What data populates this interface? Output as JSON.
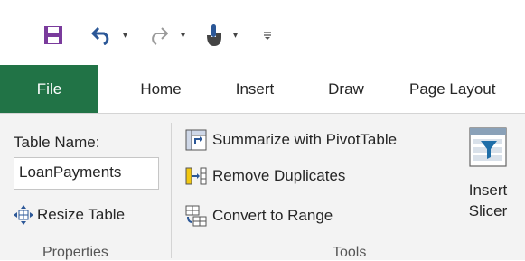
{
  "quick_access": {
    "icons": [
      "save-icon",
      "undo-icon",
      "redo-icon",
      "touch-mode-icon",
      "customize-qat-icon"
    ],
    "colors": {
      "save": "#7a3b9c",
      "undo": "#2b5797",
      "redo": "#9a9a9a"
    }
  },
  "tabs": [
    {
      "label": "File"
    },
    {
      "label": "Home"
    },
    {
      "label": "Insert"
    },
    {
      "label": "Draw"
    },
    {
      "label": "Page Layout"
    }
  ],
  "properties": {
    "table_name_label": "Table Name:",
    "table_name_value": "LoanPayments",
    "resize_label": "Resize Table",
    "group_label": "Properties"
  },
  "tools": {
    "summarize_label": "Summarize with PivotTable",
    "remove_duplicates_label": "Remove Duplicates",
    "convert_label": "Convert to Range",
    "group_label": "Tools"
  },
  "slicer": {
    "line1": "Insert",
    "line2": "Slicer"
  },
  "accent": "#217346"
}
